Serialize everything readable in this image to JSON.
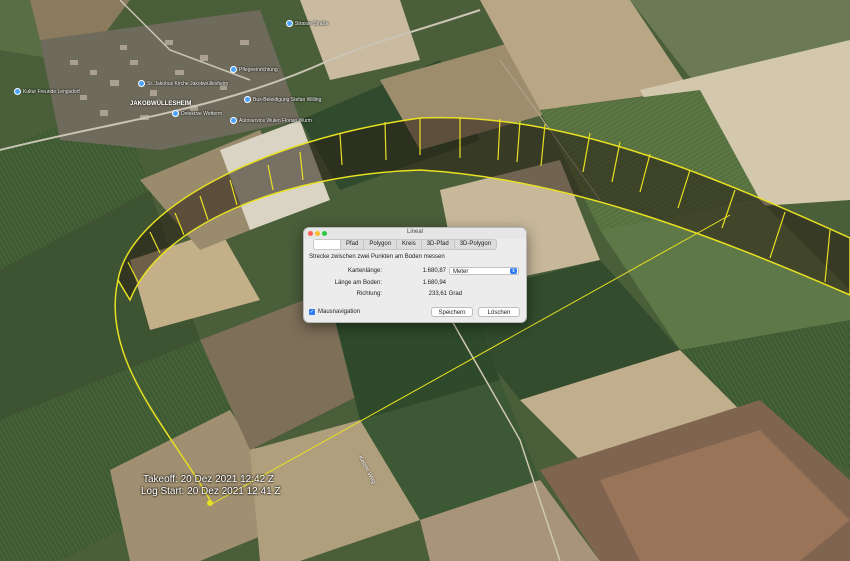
{
  "map": {
    "places": {
      "kirche": "St. Jakobus Kirche Jakobwüllesheim",
      "pflegeeinrichtung": "Pflegeeinrichtung",
      "kulturverein": "Kultur Freunde Lengsdorf",
      "village": "JAKOBWÜLLESHEIM",
      "bus": "Bus-Beleidigung Stefan Willing",
      "detektei": "Detektive Wetterm",
      "autoservice": "Autoservice Wulen Florian Wurm",
      "strasse": "Strasse Straße",
      "road_name": "Kelzer Weg"
    },
    "flight": {
      "takeoff": "Takeoff: 20 Dez 2021 12:42 Z",
      "log_start": "Log Start: 20 Dez 2021 12:41 Z"
    }
  },
  "ruler": {
    "title": "Lineal",
    "tabs": [
      "",
      "Pfad",
      "Polygon",
      "Kreis",
      "3D-Pfad",
      "3D-Polygon"
    ],
    "description": "Strecke zwischen zwei Punkten am Boden messen",
    "map_length_label": "Kartenlänge:",
    "map_length_value": "1.680,87",
    "unit": "Meter",
    "ground_length_label": "Länge am Boden:",
    "ground_length_value": "1.680,94",
    "heading_label": "Richtung:",
    "heading_value": "233,61 Grad",
    "mouse_nav_label": "Mausnavigation",
    "mouse_nav_checked": true,
    "save_label": "Speichern",
    "delete_label": "Löschen"
  },
  "colors": {
    "track": "#e8e022",
    "accent": "#2f7cf6"
  }
}
